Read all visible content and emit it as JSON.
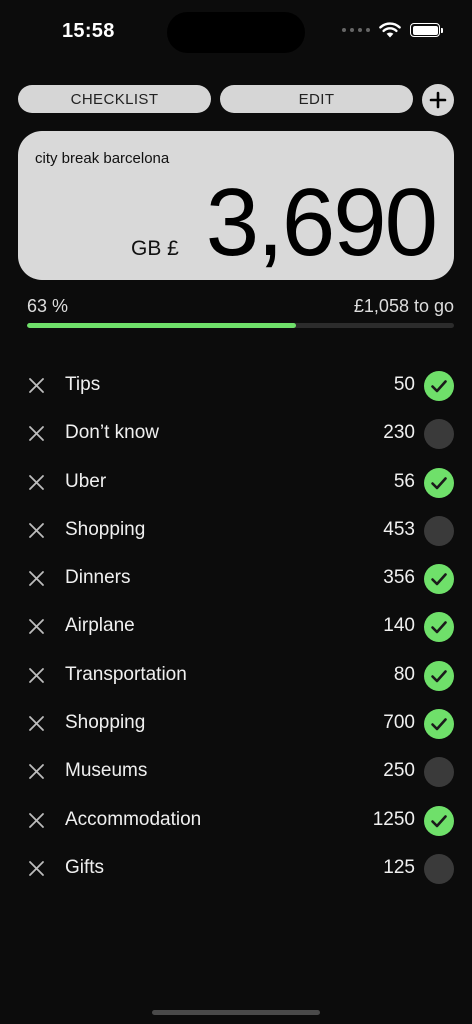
{
  "status_bar": {
    "time": "15:58"
  },
  "toolbar": {
    "checklist_label": "CHECKLIST",
    "edit_label": "EDIT",
    "add_icon": "plus-icon"
  },
  "budget": {
    "trip_name": "city break barcelona",
    "currency": "GB £",
    "amount": "3,690"
  },
  "progress": {
    "percent_label": "63 %",
    "percent_value": 63,
    "remaining_label": "£1,058 to go",
    "fill_color": "#6fe06a"
  },
  "colors": {
    "checked": "#6fe06a",
    "unchecked": "#3a3a3a",
    "accent": "#6fe06a"
  },
  "items": [
    {
      "name": "Tips",
      "amount": "50",
      "checked": true
    },
    {
      "name": "Don’t know",
      "amount": "230",
      "checked": false
    },
    {
      "name": "Uber",
      "amount": "56",
      "checked": true
    },
    {
      "name": "Shopping",
      "amount": "453",
      "checked": false
    },
    {
      "name": "Dinners",
      "amount": "356",
      "checked": true
    },
    {
      "name": "Airplane",
      "amount": "140",
      "checked": true
    },
    {
      "name": "Transportation",
      "amount": "80",
      "checked": true
    },
    {
      "name": "Shopping",
      "amount": "700",
      "checked": true
    },
    {
      "name": "Museums",
      "amount": "250",
      "checked": false
    },
    {
      "name": "Accommodation",
      "amount": "1250",
      "checked": true
    },
    {
      "name": "Gifts",
      "amount": "125",
      "checked": false
    }
  ]
}
